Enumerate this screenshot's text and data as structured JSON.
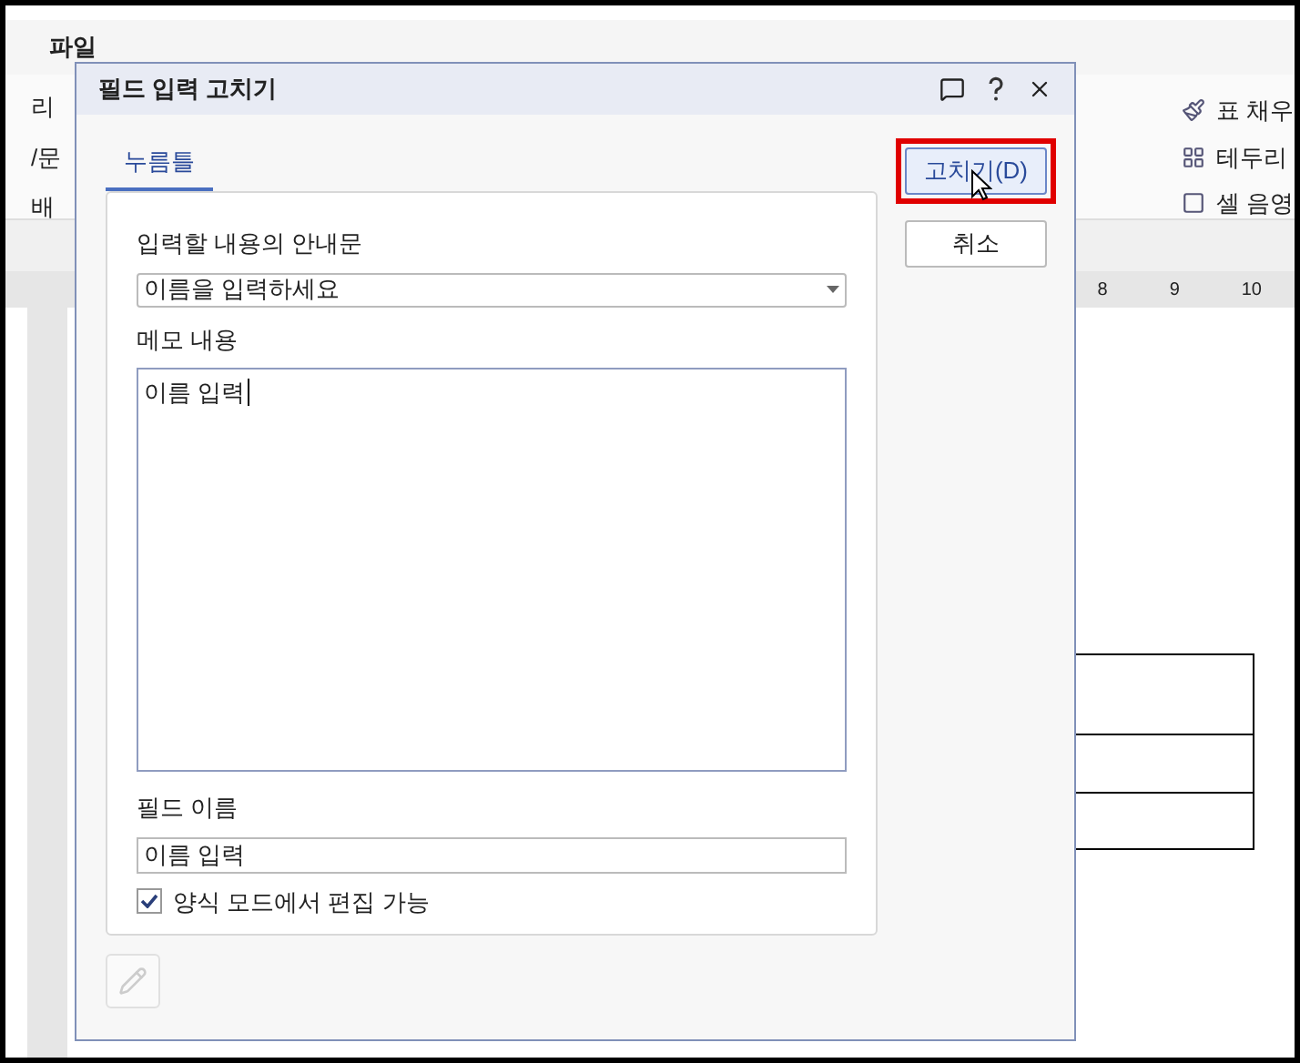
{
  "app": {
    "menu": [
      {
        "label": "파일",
        "selected": true
      }
    ],
    "ribbon_left": [
      "리",
      "/문",
      "배"
    ],
    "ribbon_right": [
      "표 채우",
      "테두리",
      "셀 음영"
    ],
    "ruler": [
      "8",
      "9",
      "10"
    ]
  },
  "dialog": {
    "title": "필드 입력 고치기",
    "tabs": [
      {
        "label": "누름틀",
        "selected": true
      }
    ],
    "guide_label": "입력할 내용의 안내문",
    "guide_value": "이름을 입력하세요",
    "memo_label": "메모 내용",
    "memo_value": "이름 입력",
    "name_label": "필드 이름",
    "name_value": "이름 입력",
    "editable": {
      "label": "양식 모드에서 편집 가능",
      "checked": true
    },
    "buttons": [
      {
        "label": "고치기(D)",
        "highlighted": true
      },
      {
        "label": "취소",
        "highlighted": false
      }
    ]
  }
}
